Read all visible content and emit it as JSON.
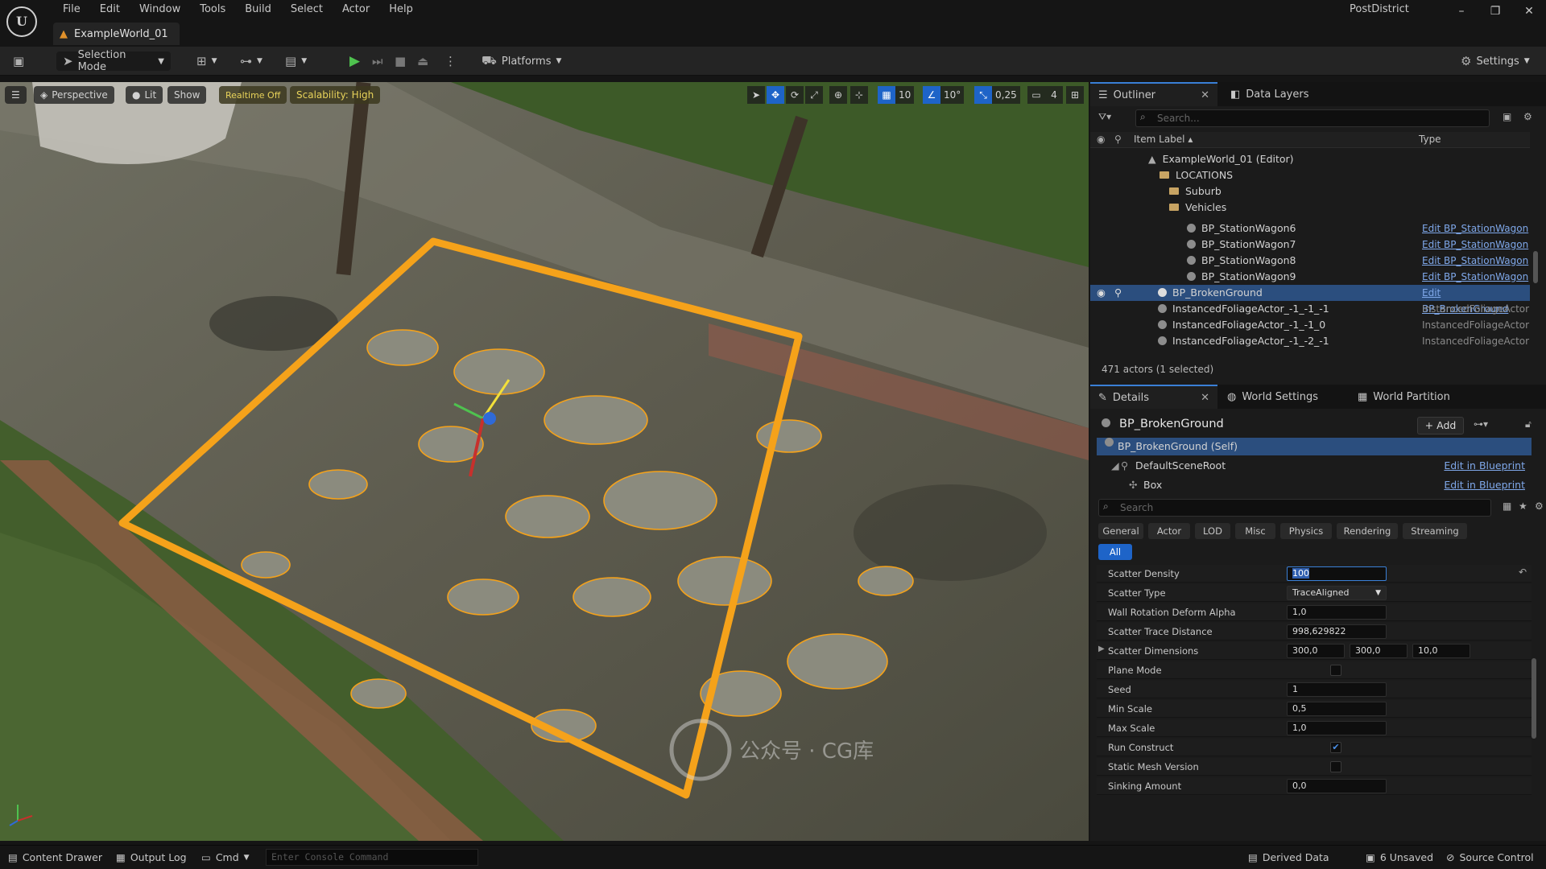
{
  "menu": [
    "File",
    "Edit",
    "Window",
    "Tools",
    "Build",
    "Select",
    "Actor",
    "Help"
  ],
  "document_tab": "ExampleWorld_01",
  "project_name": "PostDistrict",
  "toolbar": {
    "selection_mode": "Selection Mode",
    "platforms": "Platforms",
    "settings": "Settings"
  },
  "viewport": {
    "perspective": "Perspective",
    "lit": "Lit",
    "show": "Show",
    "realtime": "Realtime Off",
    "scalability": "Scalability: High",
    "grid_snap": "10",
    "rotation_snap": "10°",
    "scale_snap": "0,25",
    "camera_speed": "4"
  },
  "outliner": {
    "tab": "Outliner",
    "data_layers_tab": "Data Layers",
    "search_placeholder": "Search...",
    "col_label": "Item Label ▴",
    "col_type": "Type",
    "rows": [
      {
        "label": "ExampleWorld_01 (Editor)",
        "type": "",
        "kind": "world"
      },
      {
        "label": "LOCATIONS",
        "type": "",
        "kind": "folder"
      },
      {
        "label": "Suburb",
        "type": "",
        "kind": "folder"
      },
      {
        "label": "Vehicles",
        "type": "",
        "kind": "folder"
      },
      {
        "label": "BP_StationWagon6",
        "type": "Edit BP_StationWagon",
        "kind": "actor"
      },
      {
        "label": "BP_StationWagon7",
        "type": "Edit BP_StationWagon",
        "kind": "actor"
      },
      {
        "label": "BP_StationWagon8",
        "type": "Edit BP_StationWagon",
        "kind": "actor"
      },
      {
        "label": "BP_StationWagon9",
        "type": "Edit BP_StationWagon",
        "kind": "actor"
      },
      {
        "label": "BP_BrokenGround",
        "type": "Edit BP_BrokenGround",
        "kind": "actor"
      },
      {
        "label": "InstancedFoliageActor_-1_-1_-1",
        "type": "InstancedFoliageActor",
        "kind": "actor"
      },
      {
        "label": "InstancedFoliageActor_-1_-1_0",
        "type": "InstancedFoliageActor",
        "kind": "actor"
      },
      {
        "label": "InstancedFoliageActor_-1_-2_-1",
        "type": "InstancedFoliageActor",
        "kind": "actor"
      }
    ],
    "actor_count": "471 actors (1 selected)"
  },
  "details": {
    "tab": "Details",
    "world_settings_tab": "World Settings",
    "world_partition_tab": "World Partition",
    "title": "BP_BrokenGround",
    "add": "Add",
    "components": [
      {
        "label": "BP_BrokenGround (Self)",
        "edit": ""
      },
      {
        "label": "DefaultSceneRoot",
        "edit": "Edit in Blueprint"
      },
      {
        "label": "Box",
        "edit": "Edit in Blueprint"
      }
    ],
    "search_placeholder": "Search",
    "categories": [
      "General",
      "Actor",
      "LOD",
      "Misc",
      "Physics",
      "Rendering",
      "Streaming"
    ],
    "all": "All",
    "properties": [
      {
        "name": "Scatter Density",
        "value": "100"
      },
      {
        "name": "Scatter Type",
        "value": "TraceAligned"
      },
      {
        "name": "Wall Rotation Deform Alpha",
        "value": "1,0"
      },
      {
        "name": "Scatter Trace Distance",
        "value": "998,629822"
      },
      {
        "name": "Scatter Dimensions",
        "values": [
          "300,0",
          "300,0",
          "10,0"
        ]
      },
      {
        "name": "Plane Mode",
        "checked": false
      },
      {
        "name": "Seed",
        "value": "1"
      },
      {
        "name": "Min Scale",
        "value": "0,5"
      },
      {
        "name": "Max Scale",
        "value": "1,0"
      },
      {
        "name": "Run Construct",
        "checked": true
      },
      {
        "name": "Static Mesh Version",
        "checked": false
      },
      {
        "name": "Sinking Amount",
        "value": "0,0"
      }
    ]
  },
  "statusbar": {
    "content_drawer": "Content Drawer",
    "output_log": "Output Log",
    "cmd": "Cmd",
    "console_placeholder": "Enter Console Command",
    "derived_data": "Derived Data",
    "unsaved": "6 Unsaved",
    "source_control": "Source Control"
  },
  "watermark": "公众号 · CG库",
  "colors": {
    "accent": "#1e64c8",
    "selection_outline": "#f5a21a",
    "selected_row": "#2b4e7e"
  }
}
